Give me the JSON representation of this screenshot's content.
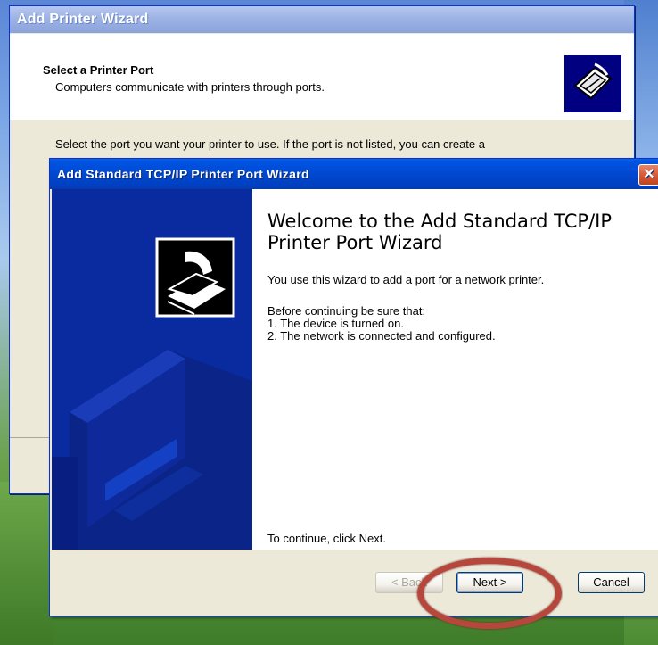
{
  "back_window": {
    "title": "Add Printer Wizard",
    "header_title": "Select a Printer Port",
    "header_subtitle": "Computers communicate with printers through ports.",
    "body_text": "Select the port you want your printer to use.  If the port is not listed, you can create a"
  },
  "dialog": {
    "title": "Add Standard TCP/IP Printer Port Wizard",
    "close_label": "✕",
    "welcome_title": "Welcome to the Add Standard TCP/IP Printer Port Wizard",
    "intro": "You use this wizard to add a port for a network printer.",
    "before_continuing": "Before continuing be sure that:",
    "items": [
      "1.  The device is turned on.",
      "2.  The network is connected and configured."
    ],
    "continue_text": "To continue, click Next.",
    "buttons": {
      "back": "< Back",
      "next": "Next >",
      "cancel": "Cancel"
    }
  },
  "colors": {
    "title_bar_blue": "#0054e3",
    "side_panel_blue": "#0a2aa0",
    "highlight_red": "#b5473d"
  }
}
